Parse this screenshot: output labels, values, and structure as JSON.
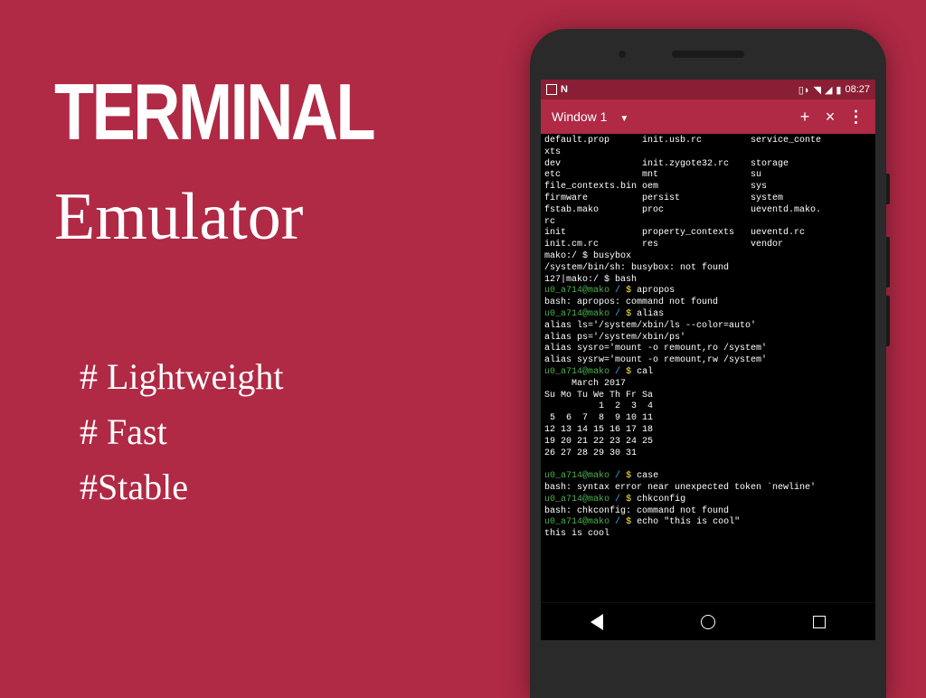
{
  "headline": {
    "title": "TERMINAL",
    "subtitle": "Emulator"
  },
  "features": [
    "# Lightweight",
    "# Fast",
    "#Stable"
  ],
  "phone": {
    "status_bar": {
      "time": "08:27",
      "left_icons": [
        "square-icon",
        "n-icon"
      ],
      "right_icons": [
        "vibrate-icon",
        "wifi-icon",
        "signal-icon",
        "battery-icon"
      ]
    },
    "app_bar": {
      "window_label": "Window 1",
      "actions": {
        "add": "+",
        "close": "×",
        "more": "⋮"
      }
    },
    "terminal_lines": [
      {
        "t": "plain",
        "text": "default.prop      init.usb.rc         service_conte"
      },
      {
        "t": "plain",
        "text": "xts"
      },
      {
        "t": "plain",
        "text": "dev               init.zygote32.rc    storage"
      },
      {
        "t": "plain",
        "text": "etc               mnt                 su"
      },
      {
        "t": "plain",
        "text": "file_contexts.bin oem                 sys"
      },
      {
        "t": "plain",
        "text": "firmware          persist             system"
      },
      {
        "t": "plain",
        "text": "fstab.mako        proc                ueventd.mako."
      },
      {
        "t": "plain",
        "text": "rc"
      },
      {
        "t": "plain",
        "text": "init              property_contexts   ueventd.rc"
      },
      {
        "t": "plain",
        "text": "init.cm.rc        res                 vendor"
      },
      {
        "t": "plain",
        "text": "mako:/ $ busybox"
      },
      {
        "t": "plain",
        "text": "/system/bin/sh: busybox: not found"
      },
      {
        "t": "plain",
        "text": "127|mako:/ $ bash"
      },
      {
        "t": "prompt",
        "user": "u0_a714@mako",
        "path": "/",
        "cmd": "apropos"
      },
      {
        "t": "plain",
        "text": "bash: apropos: command not found"
      },
      {
        "t": "prompt",
        "user": "u0_a714@mako",
        "path": "/",
        "cmd": "alias"
      },
      {
        "t": "plain",
        "text": "alias ls='/system/xbin/ls --color=auto'"
      },
      {
        "t": "plain",
        "text": "alias ps='/system/xbin/ps'"
      },
      {
        "t": "plain",
        "text": "alias sysro='mount -o remount,ro /system'"
      },
      {
        "t": "plain",
        "text": "alias sysrw='mount -o remount,rw /system'"
      },
      {
        "t": "prompt",
        "user": "u0_a714@mako",
        "path": "/",
        "cmd": "cal"
      },
      {
        "t": "plain",
        "text": "     March 2017"
      },
      {
        "t": "plain",
        "text": "Su Mo Tu We Th Fr Sa"
      },
      {
        "t": "plain",
        "text": "          1  2  3  4"
      },
      {
        "t": "plain",
        "text": " 5  6  7  8  9 10 11"
      },
      {
        "t": "plain",
        "text": "12 13 14 15 16 17 18"
      },
      {
        "t": "plain",
        "text": "19 20 21 22 23 24 25"
      },
      {
        "t": "plain",
        "text": "26 27 28 29 30 31"
      },
      {
        "t": "plain",
        "text": ""
      },
      {
        "t": "prompt",
        "user": "u0_a714@mako",
        "path": "/",
        "cmd": "case"
      },
      {
        "t": "plain",
        "text": "bash: syntax error near unexpected token `newline'"
      },
      {
        "t": "prompt",
        "user": "u0_a714@mako",
        "path": "/",
        "cmd": "chkconfig"
      },
      {
        "t": "plain",
        "text": "bash: chkconfig: command not found"
      },
      {
        "t": "prompt",
        "user": "u0_a714@mako",
        "path": "/",
        "cmd": "echo \"this is cool\""
      },
      {
        "t": "plain",
        "text": "this is cool"
      }
    ],
    "nav_bar": [
      "back",
      "home",
      "recent"
    ]
  }
}
